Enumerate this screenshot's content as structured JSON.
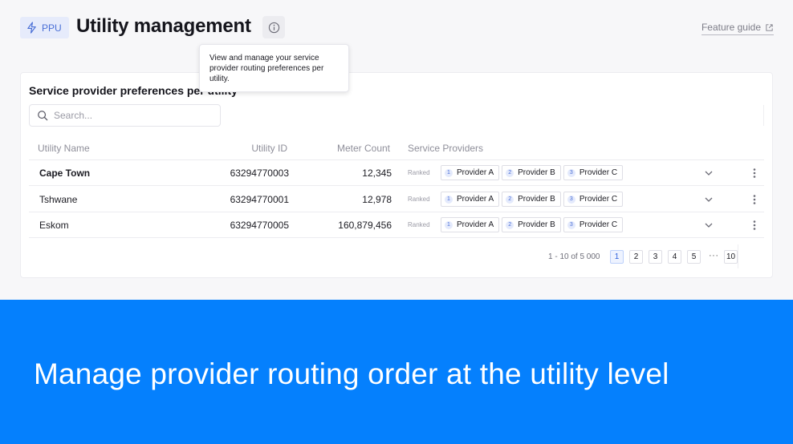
{
  "header": {
    "badge_label": "PPU",
    "badge_icon": "lightning-icon",
    "title": "Utility management",
    "info_icon": "info-icon",
    "feature_guide_label": "Feature guide",
    "feature_guide_icon": "external-link-icon"
  },
  "tooltip": {
    "text": "View and manage your service provider routing preferences per utility."
  },
  "card": {
    "title": "Service provider preferences per utility",
    "search": {
      "placeholder": "Search...",
      "value": ""
    },
    "columns": [
      "Utility Name",
      "Utility ID",
      "Meter Count",
      "Service Providers"
    ],
    "rows": [
      {
        "name": "Cape Town",
        "id": "63294770003",
        "count": "12,345",
        "ranked": "Ranked",
        "providers": [
          {
            "rank": "1",
            "label": "Provider A"
          },
          {
            "rank": "2",
            "label": "Provider B"
          },
          {
            "rank": "3",
            "label": "Provider C"
          }
        ]
      },
      {
        "name": "Tshwane",
        "id": "63294770001",
        "count": "12,978",
        "ranked": "Ranked",
        "providers": [
          {
            "rank": "1",
            "label": "Provider A"
          },
          {
            "rank": "2",
            "label": "Provider B"
          },
          {
            "rank": "3",
            "label": "Provider C"
          }
        ]
      },
      {
        "name": "Eskom",
        "id": "63294770005",
        "count": "160,879,456",
        "ranked": "Ranked",
        "providers": [
          {
            "rank": "1",
            "label": "Provider A"
          },
          {
            "rank": "2",
            "label": "Provider B"
          },
          {
            "rank": "3",
            "label": "Provider C"
          }
        ]
      }
    ],
    "pagination": {
      "info": "1 - 10 of 5 000",
      "pages": [
        "1",
        "2",
        "3",
        "4",
        "5"
      ],
      "ellipsis": "···",
      "last": "10",
      "current": "1"
    }
  },
  "banner": {
    "text": "Manage provider routing order at the utility level"
  },
  "colors": {
    "accent": "#0580fd",
    "badge_bg": "#e6ebfb",
    "badge_fg": "#4a6fd6"
  }
}
